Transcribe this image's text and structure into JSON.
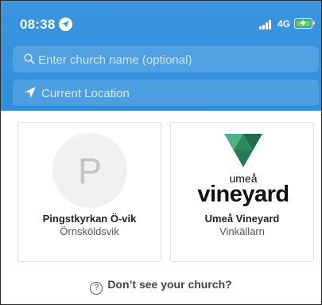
{
  "status_bar": {
    "time": "08:38",
    "network": "4G",
    "battery_color": "#5dd84a"
  },
  "search": {
    "placeholder": "Enter church name (optional)",
    "icon": "search-icon"
  },
  "location": {
    "label": "Current Location",
    "icon": "location-arrow-icon"
  },
  "churches": [
    {
      "avatar_letter": "P",
      "name": "Pingstkyrkan Ö-vik",
      "city": "Örnsköldsvik"
    },
    {
      "logo_small": "umeå",
      "logo_big": "vineyard",
      "name": "Umeå Vineyard",
      "city": "Vinkällarn"
    }
  ],
  "footer": {
    "help_label": "Don’t see your church?",
    "icon": "question-icon"
  },
  "colors": {
    "header": "#3294df",
    "logo_green": "#2e8a5c"
  }
}
